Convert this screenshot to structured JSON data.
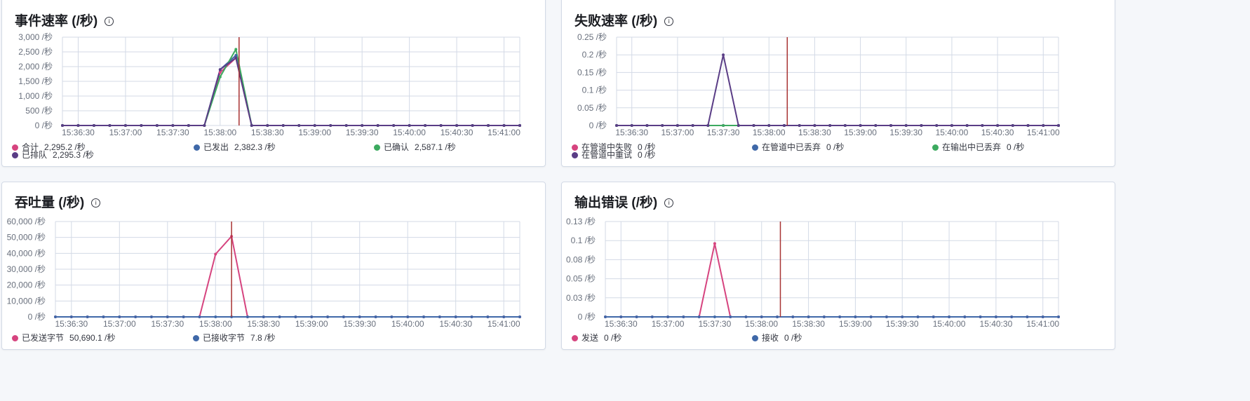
{
  "colors": {
    "pink": "#d6447f",
    "blue": "#3f68a8",
    "green": "#3caa5f",
    "purple": "#5a3d86",
    "marker": "#a83232",
    "grid": "#d3dae6"
  },
  "panels": [
    {
      "title": "事件速率 (/秒)",
      "legend": [
        {
          "label": "合计",
          "value": "2,295.2 /秒",
          "color": "#d6447f"
        },
        {
          "label": "已发出",
          "value": "2,382.3 /秒",
          "color": "#3f68a8"
        },
        {
          "label": "已确认",
          "value": "2,587.1 /秒",
          "color": "#3caa5f"
        },
        {
          "label": "已排队",
          "value": "2,295.3 /秒",
          "color": "#5a3d86"
        }
      ]
    },
    {
      "title": "失败速率 (/秒)",
      "legend": [
        {
          "label": "在管道中失败",
          "value": "0 /秒",
          "color": "#d6447f"
        },
        {
          "label": "在管道中已丢弃",
          "value": "0 /秒",
          "color": "#3f68a8"
        },
        {
          "label": "在输出中已丢弃",
          "value": "0 /秒",
          "color": "#3caa5f"
        },
        {
          "label": "在管道中重试",
          "value": "0 /秒",
          "color": "#5a3d86"
        }
      ]
    },
    {
      "title": "吞吐量 (/秒)",
      "legend": [
        {
          "label": "已发送字节",
          "value": "50,690.1 /秒",
          "color": "#d6447f"
        },
        {
          "label": "已接收字节",
          "value": "7.8 /秒",
          "color": "#3f68a8"
        }
      ]
    },
    {
      "title": "输出错误 (/秒)",
      "legend": [
        {
          "label": "发送",
          "value": "0 /秒",
          "color": "#d6447f"
        },
        {
          "label": "接收",
          "value": "0 /秒",
          "color": "#3f68a8"
        }
      ]
    }
  ],
  "chart_data": [
    {
      "type": "line",
      "title": "事件速率 (/秒)",
      "x": [
        "15:36:20",
        "15:36:30",
        "15:36:40",
        "15:36:50",
        "15:37:00",
        "15:37:10",
        "15:37:20",
        "15:37:30",
        "15:37:40",
        "15:37:50",
        "15:38:00",
        "15:38:10",
        "15:38:20",
        "15:38:30",
        "15:38:40",
        "15:38:50",
        "15:39:00",
        "15:39:10",
        "15:39:20",
        "15:39:30",
        "15:39:40",
        "15:39:50",
        "15:40:00",
        "15:40:10",
        "15:40:20",
        "15:40:30",
        "15:40:40",
        "15:40:50",
        "15:41:00",
        "15:41:10"
      ],
      "xticks": [
        "15:36:30",
        "15:37:00",
        "15:37:30",
        "15:38:00",
        "15:38:30",
        "15:39:00",
        "15:39:30",
        "15:40:00",
        "15:40:30",
        "15:41:00"
      ],
      "yticks": [
        "0 /秒",
        "500 /秒",
        "1,000 /秒",
        "1,500 /秒",
        "2,000 /秒",
        "2,500 /秒",
        "3,000 /秒"
      ],
      "ylim": [
        0,
        3000
      ],
      "marker_x": "15:38:12",
      "series": [
        {
          "name": "合计",
          "color": "#d6447f",
          "values": [
            0,
            0,
            0,
            0,
            0,
            0,
            0,
            0,
            0,
            0,
            1800,
            2295,
            0,
            0,
            0,
            0,
            0,
            0,
            0,
            0,
            0,
            0,
            0,
            0,
            0,
            0,
            0,
            0,
            0,
            0
          ]
        },
        {
          "name": "已发出",
          "color": "#3f68a8",
          "values": [
            0,
            0,
            0,
            0,
            0,
            0,
            0,
            0,
            0,
            0,
            1900,
            2382,
            0,
            0,
            0,
            0,
            0,
            0,
            0,
            0,
            0,
            0,
            0,
            0,
            0,
            0,
            0,
            0,
            0,
            0
          ]
        },
        {
          "name": "已确认",
          "color": "#3caa5f",
          "values": [
            0,
            0,
            0,
            0,
            0,
            0,
            0,
            0,
            0,
            0,
            1650,
            2587,
            0,
            0,
            0,
            0,
            0,
            0,
            0,
            0,
            0,
            0,
            0,
            0,
            0,
            0,
            0,
            0,
            0,
            0
          ]
        },
        {
          "name": "已排队",
          "color": "#5a3d86",
          "values": [
            0,
            0,
            0,
            0,
            0,
            0,
            0,
            0,
            0,
            0,
            1900,
            2295,
            0,
            0,
            0,
            0,
            0,
            0,
            0,
            0,
            0,
            0,
            0,
            0,
            0,
            0,
            0,
            0,
            0,
            0
          ]
        }
      ]
    },
    {
      "type": "line",
      "title": "失败速率 (/秒)",
      "x": [
        "15:36:20",
        "15:36:30",
        "15:36:40",
        "15:36:50",
        "15:37:00",
        "15:37:10",
        "15:37:20",
        "15:37:30",
        "15:37:40",
        "15:37:50",
        "15:38:00",
        "15:38:10",
        "15:38:20",
        "15:38:30",
        "15:38:40",
        "15:38:50",
        "15:39:00",
        "15:39:10",
        "15:39:20",
        "15:39:30",
        "15:39:40",
        "15:39:50",
        "15:40:00",
        "15:40:10",
        "15:40:20",
        "15:40:30",
        "15:40:40",
        "15:40:50",
        "15:41:00",
        "15:41:10"
      ],
      "xticks": [
        "15:36:30",
        "15:37:00",
        "15:37:30",
        "15:38:00",
        "15:38:30",
        "15:39:00",
        "15:39:30",
        "15:40:00",
        "15:40:30",
        "15:41:00"
      ],
      "yticks": [
        "0 /秒",
        "0.05 /秒",
        "0.1 /秒",
        "0.15 /秒",
        "0.2 /秒",
        "0.25 /秒"
      ],
      "ylim": [
        0,
        0.25
      ],
      "marker_x": "15:38:12",
      "series": [
        {
          "name": "在管道中失败",
          "color": "#d6447f",
          "values": [
            0,
            0,
            0,
            0,
            0,
            0,
            0,
            0,
            0,
            0,
            0,
            0,
            0,
            0,
            0,
            0,
            0,
            0,
            0,
            0,
            0,
            0,
            0,
            0,
            0,
            0,
            0,
            0,
            0,
            0
          ]
        },
        {
          "name": "在管道中已丢弃",
          "color": "#3f68a8",
          "values": [
            0,
            0,
            0,
            0,
            0,
            0,
            0,
            0,
            0,
            0,
            0,
            0,
            0,
            0,
            0,
            0,
            0,
            0,
            0,
            0,
            0,
            0,
            0,
            0,
            0,
            0,
            0,
            0,
            0,
            0
          ]
        },
        {
          "name": "在输出中已丢弃",
          "color": "#3caa5f",
          "values": [
            0,
            0,
            0,
            0,
            0,
            0,
            0,
            0,
            0,
            0,
            0,
            0,
            0,
            0,
            0,
            0,
            0,
            0,
            0,
            0,
            0,
            0,
            0,
            0,
            0,
            0,
            0,
            0,
            0,
            0
          ]
        },
        {
          "name": "在管道中重试",
          "color": "#5a3d86",
          "values": [
            0,
            0,
            0,
            0,
            0,
            0,
            0,
            0.2,
            0,
            0,
            0,
            0,
            0,
            0,
            0,
            0,
            0,
            0,
            0,
            0,
            0,
            0,
            0,
            0,
            0,
            0,
            0,
            0,
            0,
            0
          ]
        }
      ]
    },
    {
      "type": "line",
      "title": "吞吐量 (/秒)",
      "x": [
        "15:36:20",
        "15:36:30",
        "15:36:40",
        "15:36:50",
        "15:37:00",
        "15:37:10",
        "15:37:20",
        "15:37:30",
        "15:37:40",
        "15:37:50",
        "15:38:00",
        "15:38:10",
        "15:38:20",
        "15:38:30",
        "15:38:40",
        "15:38:50",
        "15:39:00",
        "15:39:10",
        "15:39:20",
        "15:39:30",
        "15:39:40",
        "15:39:50",
        "15:40:00",
        "15:40:10",
        "15:40:20",
        "15:40:30",
        "15:40:40",
        "15:40:50",
        "15:41:00",
        "15:41:10"
      ],
      "xticks": [
        "15:36:30",
        "15:37:00",
        "15:37:30",
        "15:38:00",
        "15:38:30",
        "15:39:00",
        "15:39:30",
        "15:40:00",
        "15:40:30",
        "15:41:00"
      ],
      "yticks": [
        "0 /秒",
        "10,000 /秒",
        "20,000 /秒",
        "30,000 /秒",
        "40,000 /秒",
        "50,000 /秒",
        "60,000 /秒"
      ],
      "ylim": [
        0,
        60000
      ],
      "marker_x": "15:38:10",
      "series": [
        {
          "name": "已发送字节",
          "color": "#d6447f",
          "values": [
            0,
            0,
            0,
            0,
            0,
            0,
            0,
            0,
            0,
            0,
            39500,
            50690,
            0,
            0,
            0,
            0,
            0,
            0,
            0,
            0,
            0,
            0,
            0,
            0,
            0,
            0,
            0,
            0,
            0,
            0
          ]
        },
        {
          "name": "已接收字节",
          "color": "#3f68a8",
          "values": [
            0,
            0,
            0,
            0,
            0,
            0,
            0,
            0,
            0,
            0,
            0,
            8,
            0,
            0,
            0,
            0,
            0,
            0,
            0,
            0,
            0,
            0,
            0,
            0,
            0,
            0,
            0,
            0,
            0,
            0
          ]
        }
      ]
    },
    {
      "type": "line",
      "title": "输出错误 (/秒)",
      "x": [
        "15:36:20",
        "15:36:30",
        "15:36:40",
        "15:36:50",
        "15:37:00",
        "15:37:10",
        "15:37:20",
        "15:37:30",
        "15:37:40",
        "15:37:50",
        "15:38:00",
        "15:38:10",
        "15:38:20",
        "15:38:30",
        "15:38:40",
        "15:38:50",
        "15:39:00",
        "15:39:10",
        "15:39:20",
        "15:39:30",
        "15:39:40",
        "15:39:50",
        "15:40:00",
        "15:40:10",
        "15:40:20",
        "15:40:30",
        "15:40:40",
        "15:40:50",
        "15:41:00",
        "15:41:10"
      ],
      "xticks": [
        "15:36:30",
        "15:37:00",
        "15:37:30",
        "15:38:00",
        "15:38:30",
        "15:39:00",
        "15:39:30",
        "15:40:00",
        "15:40:30",
        "15:41:00"
      ],
      "yticks": [
        "0 /秒",
        "0.03 /秒",
        "0.05 /秒",
        "0.08 /秒",
        "0.1 /秒",
        "0.13 /秒"
      ],
      "ylim": [
        0,
        0.13
      ],
      "marker_x": "15:38:12",
      "series": [
        {
          "name": "发送",
          "color": "#d6447f",
          "values": [
            0,
            0,
            0,
            0,
            0,
            0,
            0,
            0.1,
            0,
            0,
            0,
            0,
            0,
            0,
            0,
            0,
            0,
            0,
            0,
            0,
            0,
            0,
            0,
            0,
            0,
            0,
            0,
            0,
            0,
            0
          ]
        },
        {
          "name": "接收",
          "color": "#3f68a8",
          "values": [
            0,
            0,
            0,
            0,
            0,
            0,
            0,
            0,
            0,
            0,
            0,
            0,
            0,
            0,
            0,
            0,
            0,
            0,
            0,
            0,
            0,
            0,
            0,
            0,
            0,
            0,
            0,
            0,
            0,
            0
          ]
        }
      ]
    }
  ]
}
